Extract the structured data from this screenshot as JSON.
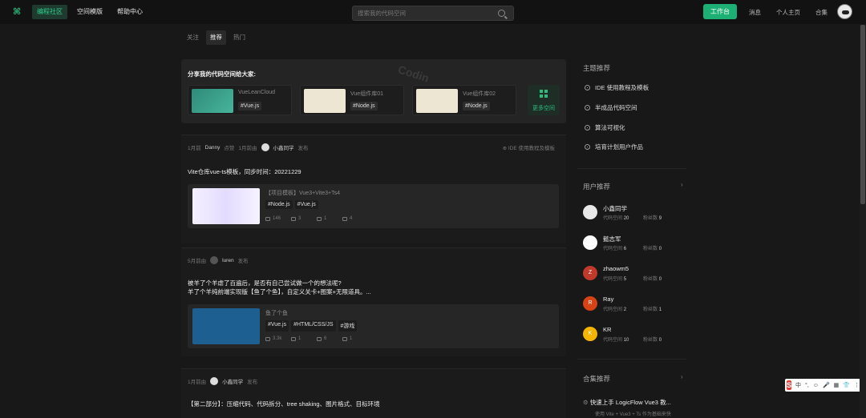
{
  "nav": {
    "items": [
      {
        "label": "编程社区",
        "active": true
      },
      {
        "label": "空间模版",
        "active": false
      },
      {
        "label": "帮助中心",
        "active": false
      }
    ]
  },
  "search": {
    "placeholder": "搜索我的代码空间"
  },
  "header": {
    "work_button": "工作台",
    "messages": "消息",
    "profile": "个人主页",
    "collections": "合集"
  },
  "feed_tabs": [
    {
      "label": "关注",
      "active": false
    },
    {
      "label": "推荐",
      "active": true
    },
    {
      "label": "热门",
      "active": false
    }
  ],
  "share": {
    "title": "分享我的代码空间给大家:",
    "cards": [
      {
        "name": "VueLeanCloud",
        "tag": "#Vue.js"
      },
      {
        "name": "Vue组件库01",
        "tag": "#Node.js"
      },
      {
        "name": "Vue组件库02",
        "tag": "#Node.js"
      }
    ],
    "more_label": "更多空间"
  },
  "posts": [
    {
      "time": "1月前",
      "actor": "Danny",
      "action": "点赞",
      "time2": "1月前由",
      "author": "小鑫同学",
      "verb": "发布",
      "category": "IDE 使用教程及模板",
      "title_lines": [
        "Vite仓库vue-ts模板，同步时间：20221229"
      ],
      "item_title": "【项目模板】Vue3+Vite3+Ts4",
      "tags": [
        "#Node.js",
        "#Vue.js"
      ],
      "stats": [
        "146",
        "3",
        "1",
        "4"
      ]
    },
    {
      "time": "5月前由",
      "author": "luren",
      "verb": "发布",
      "title_lines": [
        "被羊了个羊虐了百遍后，是否有自己尝试做一个的想法呢?",
        "羊了个羊纯前端实现版【鱼了个鱼】，自定义关卡+图案+无限道具。..."
      ],
      "item_title": "鱼了个鱼",
      "tags": [
        "#Vue.js",
        "#HTML/CSS/JS",
        "#游戏"
      ],
      "stats": [
        "3.3k",
        "1",
        "6",
        "1"
      ]
    },
    {
      "time": "1月前由",
      "author": "小鑫同学",
      "verb": "发布",
      "title_lines": [
        "【第二部分】：压缩代码、代码拆分、tree shaking、图片格式、目标环境"
      ]
    }
  ],
  "sidebar": {
    "topics_title": "主题推荐",
    "topics": [
      "IDE 使用教程及模板",
      "半成品代码空间",
      "算法可视化",
      "培育计划用户作品"
    ],
    "users_title": "用户推荐",
    "stat_space_label": "代码空间",
    "stat_fans_label": "粉丝数",
    "users": [
      {
        "name": "小鑫同学",
        "initial": "",
        "color": "#e8e8e8",
        "spaces": "20",
        "fans": "9"
      },
      {
        "name": "懿志军",
        "initial": "",
        "color": "#ffffff",
        "spaces": "6",
        "fans": "0"
      },
      {
        "name": "zhaowm5",
        "initial": "Z",
        "color": "#c0392b",
        "spaces": "5",
        "fans": "0"
      },
      {
        "name": "Ray",
        "initial": "R",
        "color": "#d84315",
        "spaces": "2",
        "fans": "1"
      },
      {
        "name": "KR",
        "initial": "K",
        "color": "#f4b400",
        "spaces": "10",
        "fans": "0"
      }
    ],
    "collections_title": "合集推荐",
    "collection_item": "快速上手 LogicFlow Vue3 教...",
    "collection_sub": "使用 Vite + Vue3 + Ts 作为基础来快"
  },
  "ime": {
    "items": [
      "中",
      "°,",
      "☺",
      "🎤",
      "▦",
      "👕",
      "⋮⋮"
    ]
  }
}
